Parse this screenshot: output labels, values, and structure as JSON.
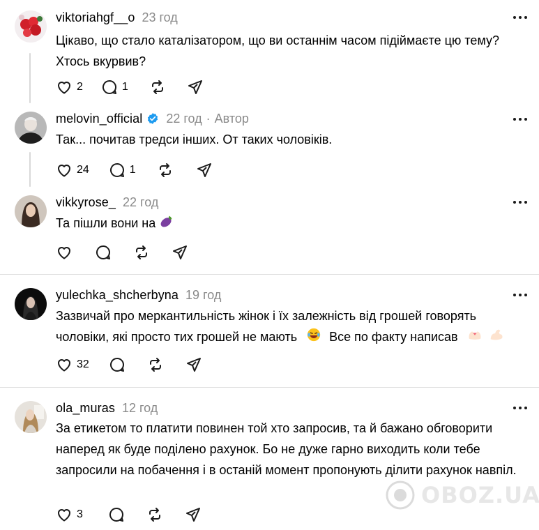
{
  "comments": [
    {
      "username": "viktoriahgf__o",
      "time": "23 год",
      "author_label": "",
      "verified": false,
      "text": "Цікаво, що стало каталізатором, що ви останнім часом підіймаєте цю тему? Хтось вкурвив?",
      "likes": "2",
      "replies": "1",
      "avatar_icon": "flowers-avatar"
    },
    {
      "username": "melovin_official",
      "time": "22 год",
      "author_label": "Автор",
      "verified": true,
      "text": "Так... почитав тредси інших. От таких чоловіків.",
      "likes": "24",
      "replies": "1",
      "avatar_icon": "man-avatar"
    },
    {
      "username": "vikkyrose_",
      "time": "22 год",
      "author_label": "",
      "verified": false,
      "text": "Та пішли вони на",
      "text_emoji": "eggplant-emoji",
      "likes": "",
      "replies": "",
      "avatar_icon": "woman-avatar"
    },
    {
      "username": "yulechka_shcherbyna",
      "time": "19 год",
      "author_label": "",
      "verified": false,
      "text": "Зазвичай про меркантильність жінок і їх залежність від грошей говорять чоловіки, які просто тих грошей не мають",
      "text_after": "Все по факту написав",
      "text_emojis": [
        "laughing-emoji",
        "heart-hands-emoji",
        "flexed-arm-emoji"
      ],
      "likes": "32",
      "replies": "",
      "avatar_icon": "woman-dark-avatar"
    },
    {
      "username": "ola_muras",
      "time": "12 год",
      "author_label": "",
      "verified": false,
      "text": "За етикетом то платити повинен той хто запросив, та й бажано обговорити наперед як буде поділено рахунок. Бо не дуже гарно виходить коли тебе запросили на побачення і в останій момент пропонують ділити рахунок навпіл.",
      "likes": "3",
      "replies": "",
      "avatar_icon": "woman-light-avatar"
    }
  ],
  "watermark": "OBOZ.UA",
  "colors": {
    "muted": "#8a8a8a",
    "verified": "#1d9bf0",
    "line": "#d9d9d9"
  }
}
